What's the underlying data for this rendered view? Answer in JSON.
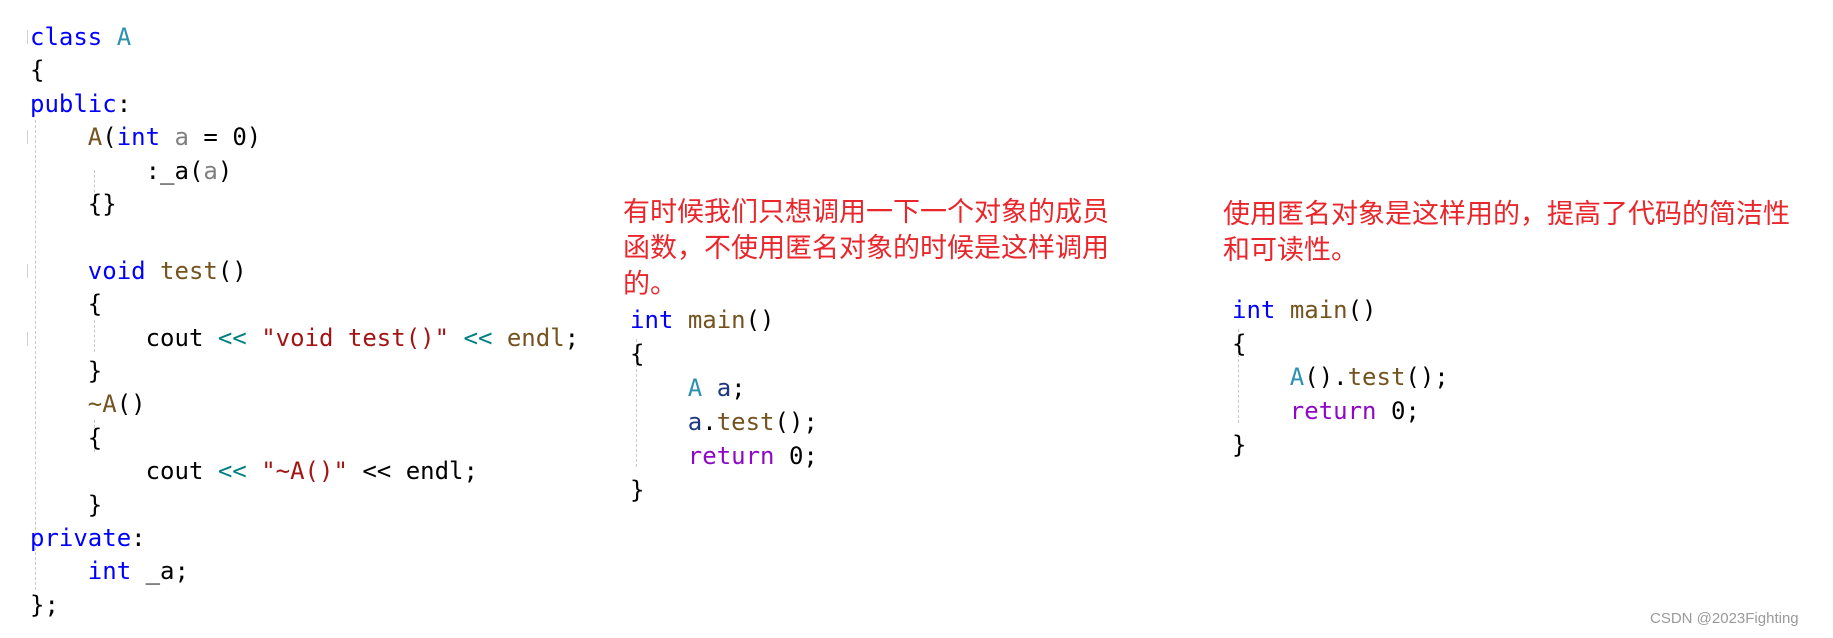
{
  "class_code": {
    "lines": [
      [
        {
          "t": "class ",
          "c": "kw"
        },
        {
          "t": "A",
          "c": "ty"
        }
      ],
      [
        {
          "t": "{",
          "c": ""
        }
      ],
      [
        {
          "t": "public",
          "c": "kw"
        },
        {
          "t": ":",
          "c": ""
        }
      ],
      [
        {
          "t": "    ",
          "c": ""
        },
        {
          "t": "A",
          "c": "fn"
        },
        {
          "t": "(",
          "c": ""
        },
        {
          "t": "int",
          "c": "kw"
        },
        {
          "t": " ",
          "c": ""
        },
        {
          "t": "a",
          "c": "pa"
        },
        {
          "t": " = 0)",
          "c": ""
        }
      ],
      [
        {
          "t": "        :_a(",
          "c": ""
        },
        {
          "t": "a",
          "c": "pa"
        },
        {
          "t": ")",
          "c": ""
        }
      ],
      [
        {
          "t": "    {}",
          "c": ""
        }
      ],
      [],
      [
        {
          "t": "    ",
          "c": ""
        },
        {
          "t": "void",
          "c": "kw"
        },
        {
          "t": " ",
          "c": ""
        },
        {
          "t": "test",
          "c": "fn"
        },
        {
          "t": "()",
          "c": ""
        }
      ],
      [
        {
          "t": "    {",
          "c": ""
        }
      ],
      [
        {
          "t": "        cout ",
          "c": ""
        },
        {
          "t": "<<",
          "c": "op"
        },
        {
          "t": " ",
          "c": ""
        },
        {
          "t": "\"void test()\"",
          "c": "st"
        },
        {
          "t": " ",
          "c": ""
        },
        {
          "t": "<<",
          "c": "op"
        },
        {
          "t": " ",
          "c": ""
        },
        {
          "t": "endl",
          "c": "fn"
        },
        {
          "t": ";",
          "c": ""
        }
      ],
      [
        {
          "t": "    }",
          "c": ""
        }
      ],
      [
        {
          "t": "    ",
          "c": ""
        },
        {
          "t": "~A",
          "c": "fn"
        },
        {
          "t": "()",
          "c": ""
        }
      ],
      [
        {
          "t": "    {",
          "c": ""
        }
      ],
      [
        {
          "t": "        cout ",
          "c": ""
        },
        {
          "t": "<<",
          "c": "op"
        },
        {
          "t": " ",
          "c": ""
        },
        {
          "t": "\"~A()\"",
          "c": "st"
        },
        {
          "t": " << endl;",
          "c": ""
        }
      ],
      [
        {
          "t": "    }",
          "c": ""
        }
      ],
      [
        {
          "t": "private",
          "c": "kw"
        },
        {
          "t": ":",
          "c": ""
        }
      ],
      [
        {
          "t": "    ",
          "c": ""
        },
        {
          "t": "int",
          "c": "kw"
        },
        {
          "t": " _a;",
          "c": ""
        }
      ],
      [
        {
          "t": "};",
          "c": ""
        }
      ]
    ]
  },
  "note_without_anonymous": {
    "lines": [
      "有时候我们只想调用一下一个对象的成员",
      "函数，不使用匿名对象的时候是这样调用",
      "的。"
    ]
  },
  "main_named": {
    "lines": [
      [
        {
          "t": "int",
          "c": "kw"
        },
        {
          "t": " ",
          "c": ""
        },
        {
          "t": "main",
          "c": "fn"
        },
        {
          "t": "()",
          "c": ""
        }
      ],
      [
        {
          "t": "{",
          "c": ""
        }
      ],
      [
        {
          "t": "    ",
          "c": ""
        },
        {
          "t": "A",
          "c": "ty"
        },
        {
          "t": " ",
          "c": ""
        },
        {
          "t": "a",
          "c": "var"
        },
        {
          "t": ";",
          "c": ""
        }
      ],
      [
        {
          "t": "    ",
          "c": ""
        },
        {
          "t": "a",
          "c": "var"
        },
        {
          "t": ".",
          "c": ""
        },
        {
          "t": "test",
          "c": "fn"
        },
        {
          "t": "();",
          "c": ""
        }
      ],
      [
        {
          "t": "    ",
          "c": ""
        },
        {
          "t": "return",
          "c": "ctl"
        },
        {
          "t": " 0;",
          "c": ""
        }
      ],
      [
        {
          "t": "}",
          "c": ""
        }
      ]
    ]
  },
  "note_with_anonymous": {
    "lines": [
      "使用匿名对象是这样用的，提高了代码的简洁性",
      "和可读性。"
    ]
  },
  "main_anonymous": {
    "lines": [
      [
        {
          "t": "int",
          "c": "kw"
        },
        {
          "t": " ",
          "c": ""
        },
        {
          "t": "main",
          "c": "fn"
        },
        {
          "t": "()",
          "c": ""
        }
      ],
      [
        {
          "t": "{",
          "c": ""
        }
      ],
      [
        {
          "t": "    ",
          "c": ""
        },
        {
          "t": "A",
          "c": "ty"
        },
        {
          "t": "().",
          "c": ""
        },
        {
          "t": "test",
          "c": "fn"
        },
        {
          "t": "();",
          "c": ""
        }
      ],
      [
        {
          "t": "    ",
          "c": ""
        },
        {
          "t": "return",
          "c": "ctl"
        },
        {
          "t": " 0;",
          "c": ""
        }
      ],
      [
        {
          "t": "}",
          "c": ""
        }
      ]
    ]
  },
  "watermark": "CSDN @2023Fighting",
  "colors": {
    "keyword": "#0000ff",
    "type": "#2b91af",
    "function": "#74531f",
    "parameter": "#808080",
    "string": "#a31515",
    "operator": "#008080",
    "control": "#8f08c4",
    "variable": "#1f377f",
    "annotation": "#e8262b"
  }
}
